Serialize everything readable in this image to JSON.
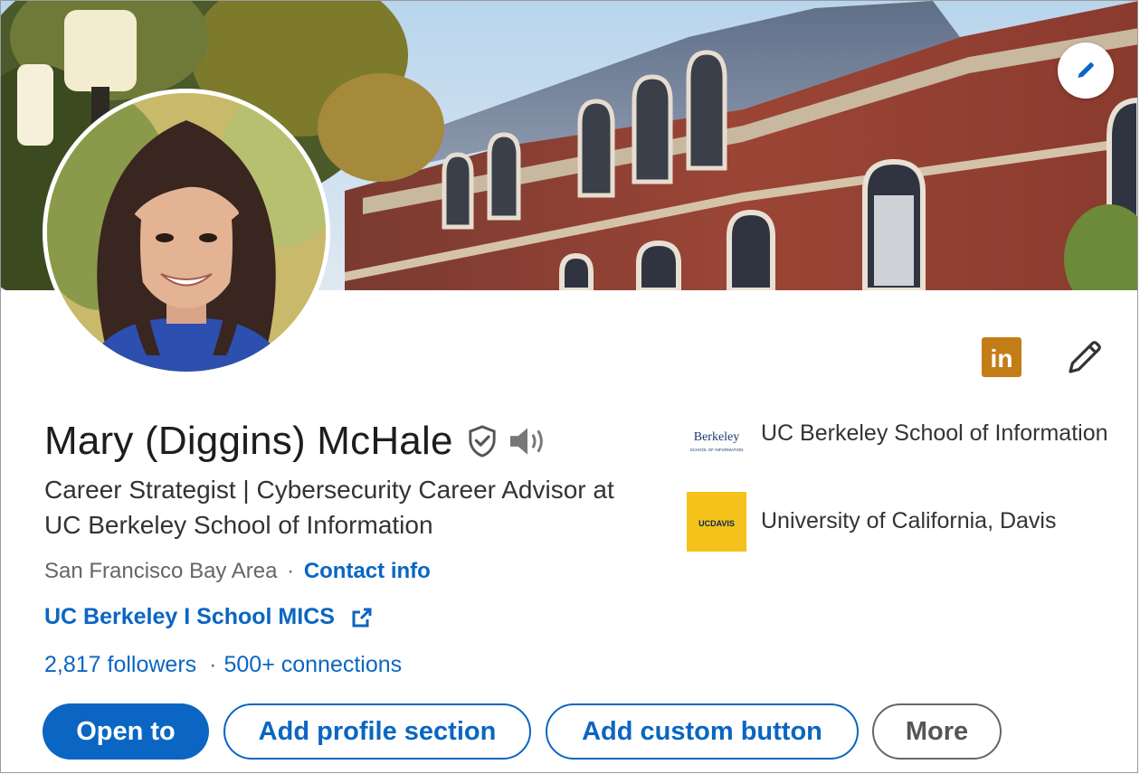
{
  "profile": {
    "name": "Mary (Diggins) McHale",
    "headline": "Career Strategist | Cybersecurity Career Advisor at UC Berkeley School of Information",
    "location": "San Francisco Bay Area",
    "location_separator": "·",
    "contact_label": "Contact info",
    "website_label": "UC Berkeley I School MICS",
    "followers": "2,817 followers",
    "stats_separator": "·",
    "connections": "500+ connections"
  },
  "education": [
    {
      "logo_text_1": "Berkeley",
      "logo_text_2": "SCHOOL OF INFORMATION",
      "name": "UC Berkeley School of Information"
    },
    {
      "logo_text_1": "UCDAVIS",
      "name": "University of California, Davis"
    }
  ],
  "badges": {
    "linkedin_text": "in"
  },
  "actions": {
    "open_to": "Open to",
    "add_profile_section": "Add profile section",
    "add_custom_button": "Add custom button",
    "more": "More"
  },
  "colors": {
    "brand_blue": "#0a66c2",
    "linkedin_badge": "#c37d16",
    "davis_gold": "#f4c21a"
  },
  "icons": {
    "banner_edit": "pencil-icon",
    "intro_edit": "pencil-icon",
    "verified": "shield-check-icon",
    "pronunciation": "speaker-icon",
    "website": "external-link-icon"
  }
}
